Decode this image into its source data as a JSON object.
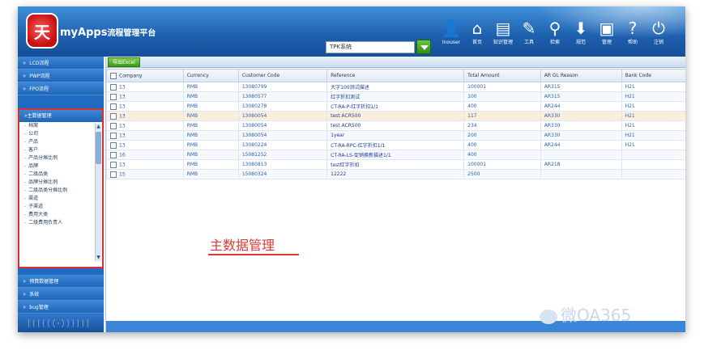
{
  "app": {
    "title": "myApps",
    "subtitle": "流程管理平台",
    "logo_text": "天"
  },
  "site_select": {
    "value": "TPK系统"
  },
  "toolbar": [
    {
      "label": "Inouser",
      "icon": "user-icon"
    },
    {
      "label": "首页",
      "icon": "home-icon"
    },
    {
      "label": "知识管理",
      "icon": "book-icon"
    },
    {
      "label": "工具",
      "icon": "tool-icon"
    },
    {
      "label": "检索",
      "icon": "search-icon"
    },
    {
      "label": "规范",
      "icon": "pin-icon"
    },
    {
      "label": "管理",
      "icon": "doc-icon"
    },
    {
      "label": "帮助",
      "icon": "help-icon"
    },
    {
      "label": "注销",
      "icon": "logout-icon"
    }
  ],
  "sidebar": {
    "top_items": [
      "LCD流程",
      "PWP流程",
      "FPO流程"
    ],
    "expanded": {
      "label": "主数据管理",
      "items": [
        "档案",
        "公司",
        "产品",
        "客户",
        "产品分摊比例",
        "品牌",
        "二级品类",
        "品牌分摊比例",
        "二级品类分摊比例",
        "渠道",
        "子渠道",
        "费用大类",
        "二级费用负责人"
      ]
    },
    "bottom_items": [
      "预算数据管理",
      "系统",
      "bug管理"
    ]
  },
  "main": {
    "export_button": "导出Excel",
    "columns": [
      "Company",
      "Currency",
      "Customer Code",
      "Reference",
      "Total Amount",
      "AR GL Reason",
      "Bank Code"
    ],
    "rows": [
      [
        "13",
        "RMB",
        "13080799",
        "大字100测试描述",
        "100001",
        "AR315",
        "H21"
      ],
      [
        "13",
        "RMB",
        "13080577",
        "红字折扣测试",
        "100",
        "AR315",
        "H21"
      ],
      [
        "13",
        "RMB",
        "13080278",
        "CT-RA-P-红字折扣1/1",
        "400",
        "AR244",
        "H21"
      ],
      [
        "13",
        "RMB",
        "13080054",
        "test ACR500",
        "117",
        "AR330",
        "H21"
      ],
      [
        "13",
        "RMB",
        "13080054",
        "test ACR500",
        "234",
        "AR330",
        "H21"
      ],
      [
        "13",
        "RMB",
        "13080054",
        "1year",
        "200",
        "AR330",
        "H21"
      ],
      [
        "13",
        "RMB",
        "13080224",
        "CT-RA-RPC-红字折扣1/1",
        "400",
        "AR244",
        "H21"
      ],
      [
        "16",
        "RMB",
        "15081252",
        "CT-RA-LS-促销换新描述1/1",
        "400",
        "",
        ""
      ],
      [
        "13",
        "RMB",
        "13080813",
        "test红字折扣",
        "100001",
        "AR218",
        ""
      ],
      [
        "15",
        "RMB",
        "15080324",
        "12222",
        "2500",
        "",
        ""
      ]
    ],
    "annotation": "主数据管理"
  },
  "watermark": "微OA365"
}
